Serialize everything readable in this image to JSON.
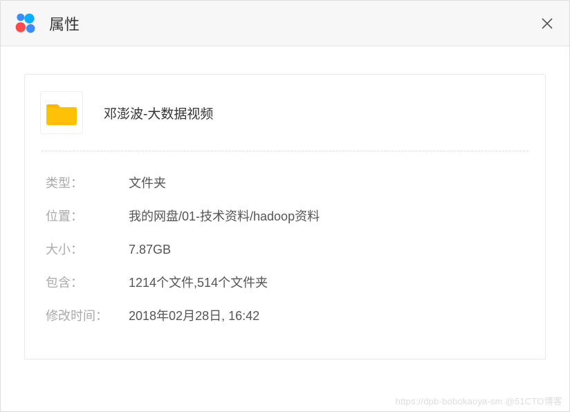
{
  "titlebar": {
    "title": "属性"
  },
  "file": {
    "name": "邓澎波-大数据视频"
  },
  "props": {
    "type_label": "类型：",
    "type_value": "文件夹",
    "location_label": "位置：",
    "location_value": "我的网盘/01-技术资料/hadoop资料",
    "size_label": "大小：",
    "size_value": "7.87GB",
    "contains_label": "包含：",
    "contains_value": "1214个文件,514个文件夹",
    "modified_label": "修改时间：",
    "modified_value": "2018年02月28日, 16:42"
  },
  "watermark": "https://dpb-bobokaoya-sm  @51CTO博客"
}
